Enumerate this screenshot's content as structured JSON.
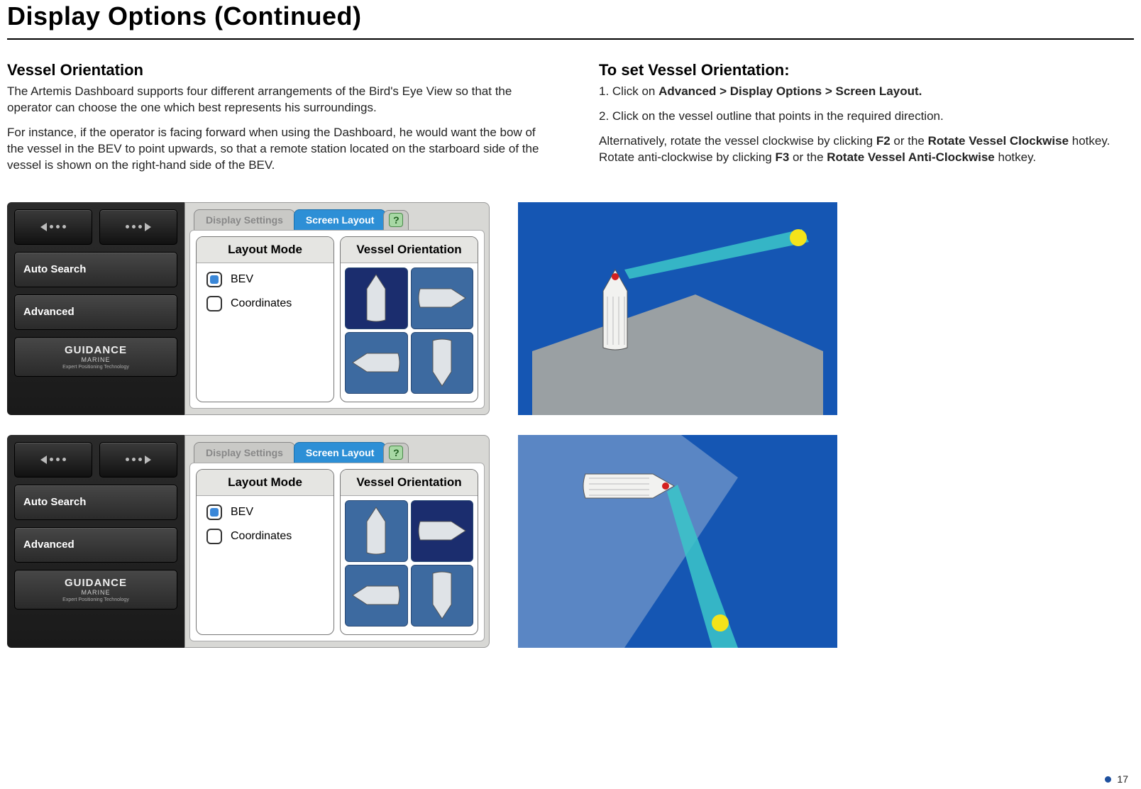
{
  "page_title": "Display Options (Continued)",
  "left": {
    "heading": "Vessel Orientation",
    "p1": "The Artemis Dashboard supports four different arrangements of the Bird's Eye View so that the operator can choose the one which best represents his surroundings.",
    "p2": "For instance, if the operator is facing forward when using the Dashboard, he would want the bow of the vessel in the BEV to point upwards, so that a remote station located on the starboard side of the vessel is shown on the right-hand side of the BEV."
  },
  "right": {
    "heading": "To set Vessel Orientation:",
    "step1_prefix": "1. Click on ",
    "step1_bold": "Advanced > Display Options > Screen Layout.",
    "step2": "2. Click on the vessel outline that points in the required direction.",
    "alt_1": "Alternatively, rotate the vessel clockwise by clicking ",
    "alt_f2": "F2",
    "alt_or1": " or the ",
    "alt_cw": "Rotate Vessel Clockwise",
    "alt_mid": " hotkey. Rotate anti-clockwise by clicking ",
    "alt_f3": "F3",
    "alt_or2": " or the ",
    "alt_acw": "Rotate Vessel Anti-Clockwise",
    "alt_end": " hotkey."
  },
  "sidebar": {
    "auto_search": "Auto Search",
    "advanced": "Advanced",
    "logo_main": "GUIDANCE",
    "logo_sub": "MARINE",
    "logo_tag": "Expert Positioning Technology"
  },
  "panel": {
    "tab_display": "Display Settings",
    "tab_layout": "Screen Layout",
    "help": "?",
    "layout_mode_head": "Layout Mode",
    "vessel_orient_head": "Vessel Orientation",
    "opt_bev": "BEV",
    "opt_coords": "Coordinates"
  },
  "screenshot1": {
    "selected_orientation": "up"
  },
  "screenshot2": {
    "selected_orientation": "right"
  },
  "page_number": "17"
}
